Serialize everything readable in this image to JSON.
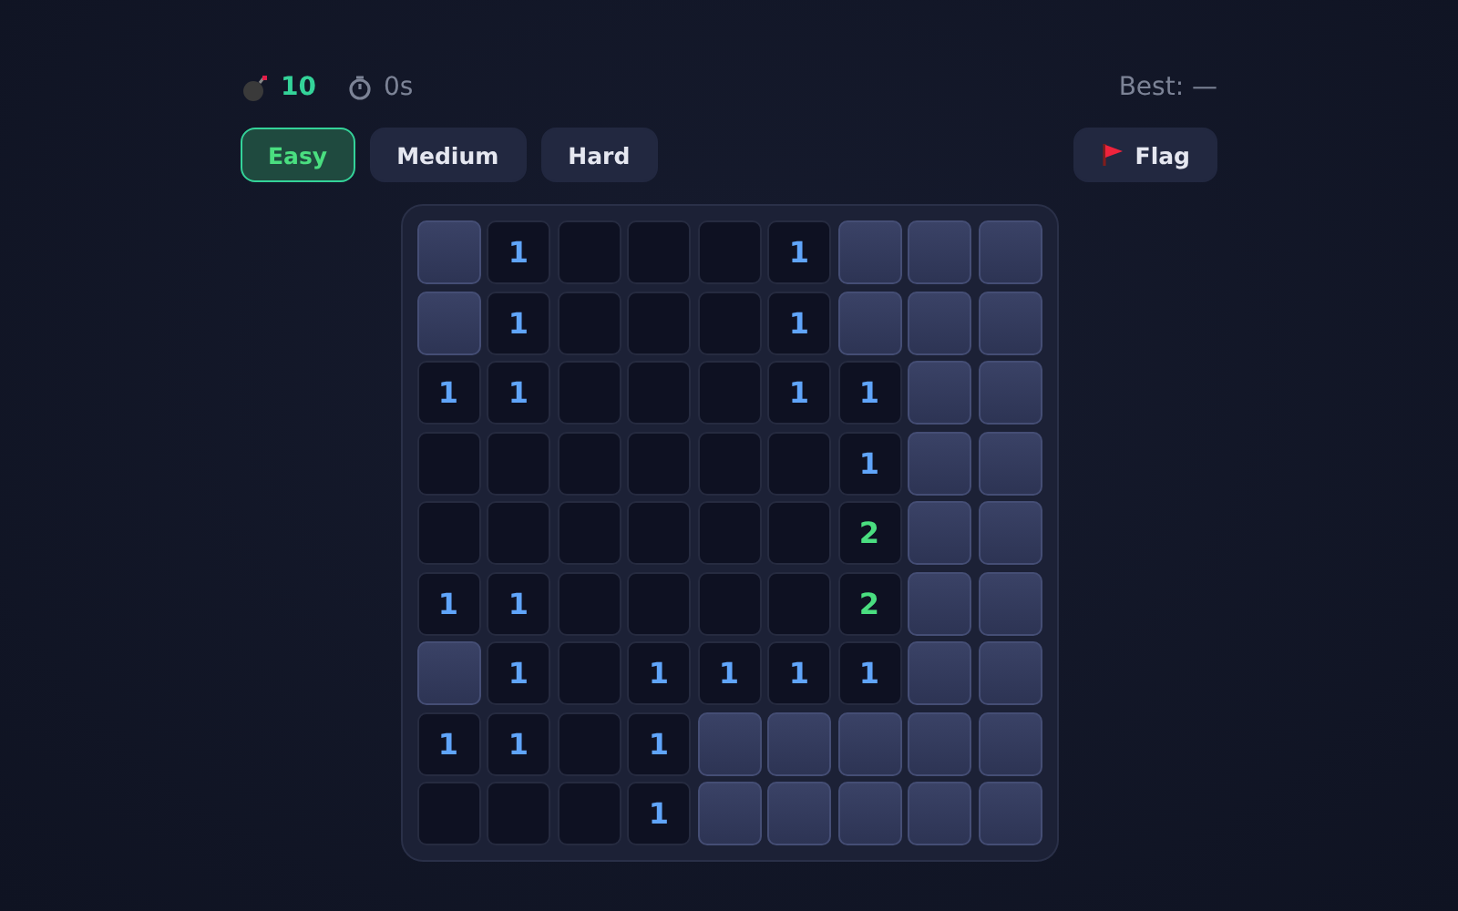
{
  "status": {
    "mines": "10",
    "time": "0s",
    "best": "Best: —"
  },
  "difficulties": [
    {
      "label": "Easy",
      "selected": true
    },
    {
      "label": "Medium",
      "selected": false
    },
    {
      "label": "Hard",
      "selected": false
    }
  ],
  "flag_button": {
    "label": "Flag",
    "selected": false
  },
  "board": [
    [
      {
        "revealed": false
      },
      {
        "revealed": true,
        "value": "1",
        "color": "#60a5fa"
      },
      {
        "revealed": true
      },
      {
        "revealed": true
      },
      {
        "revealed": true
      },
      {
        "revealed": true,
        "value": "1",
        "color": "#60a5fa"
      },
      {
        "revealed": false
      },
      {
        "revealed": false
      },
      {
        "revealed": false
      }
    ],
    [
      {
        "revealed": false
      },
      {
        "revealed": true,
        "value": "1",
        "color": "#60a5fa"
      },
      {
        "revealed": true
      },
      {
        "revealed": true
      },
      {
        "revealed": true
      },
      {
        "revealed": true,
        "value": "1",
        "color": "#60a5fa"
      },
      {
        "revealed": false
      },
      {
        "revealed": false
      },
      {
        "revealed": false
      }
    ],
    [
      {
        "revealed": true,
        "value": "1",
        "color": "#60a5fa"
      },
      {
        "revealed": true,
        "value": "1",
        "color": "#60a5fa"
      },
      {
        "revealed": true
      },
      {
        "revealed": true
      },
      {
        "revealed": true
      },
      {
        "revealed": true,
        "value": "1",
        "color": "#60a5fa"
      },
      {
        "revealed": true,
        "value": "1",
        "color": "#60a5fa"
      },
      {
        "revealed": false
      },
      {
        "revealed": false
      }
    ],
    [
      {
        "revealed": true
      },
      {
        "revealed": true
      },
      {
        "revealed": true
      },
      {
        "revealed": true
      },
      {
        "revealed": true
      },
      {
        "revealed": true
      },
      {
        "revealed": true,
        "value": "1",
        "color": "#60a5fa"
      },
      {
        "revealed": false
      },
      {
        "revealed": false
      }
    ],
    [
      {
        "revealed": true
      },
      {
        "revealed": true
      },
      {
        "revealed": true
      },
      {
        "revealed": true
      },
      {
        "revealed": true
      },
      {
        "revealed": true
      },
      {
        "revealed": true,
        "value": "2",
        "color": "#4ade80"
      },
      {
        "revealed": false
      },
      {
        "revealed": false
      }
    ],
    [
      {
        "revealed": true,
        "value": "1",
        "color": "#60a5fa"
      },
      {
        "revealed": true,
        "value": "1",
        "color": "#60a5fa"
      },
      {
        "revealed": true
      },
      {
        "revealed": true
      },
      {
        "revealed": true
      },
      {
        "revealed": true
      },
      {
        "revealed": true,
        "value": "2",
        "color": "#4ade80"
      },
      {
        "revealed": false
      },
      {
        "revealed": false
      }
    ],
    [
      {
        "revealed": false
      },
      {
        "revealed": true,
        "value": "1",
        "color": "#60a5fa"
      },
      {
        "revealed": true
      },
      {
        "revealed": true,
        "value": "1",
        "color": "#60a5fa"
      },
      {
        "revealed": true,
        "value": "1",
        "color": "#60a5fa"
      },
      {
        "revealed": true,
        "value": "1",
        "color": "#60a5fa"
      },
      {
        "revealed": true,
        "value": "1",
        "color": "#60a5fa"
      },
      {
        "revealed": false
      },
      {
        "revealed": false
      }
    ],
    [
      {
        "revealed": true,
        "value": "1",
        "color": "#60a5fa"
      },
      {
        "revealed": true,
        "value": "1",
        "color": "#60a5fa"
      },
      {
        "revealed": true
      },
      {
        "revealed": true,
        "value": "1",
        "color": "#60a5fa"
      },
      {
        "revealed": false
      },
      {
        "revealed": false
      },
      {
        "revealed": false
      },
      {
        "revealed": false
      },
      {
        "revealed": false
      }
    ],
    [
      {
        "revealed": true
      },
      {
        "revealed": true
      },
      {
        "revealed": true
      },
      {
        "revealed": true,
        "value": "1",
        "color": "#60a5fa"
      },
      {
        "revealed": false
      },
      {
        "revealed": false
      },
      {
        "revealed": false
      },
      {
        "revealed": false
      },
      {
        "revealed": false
      }
    ]
  ]
}
